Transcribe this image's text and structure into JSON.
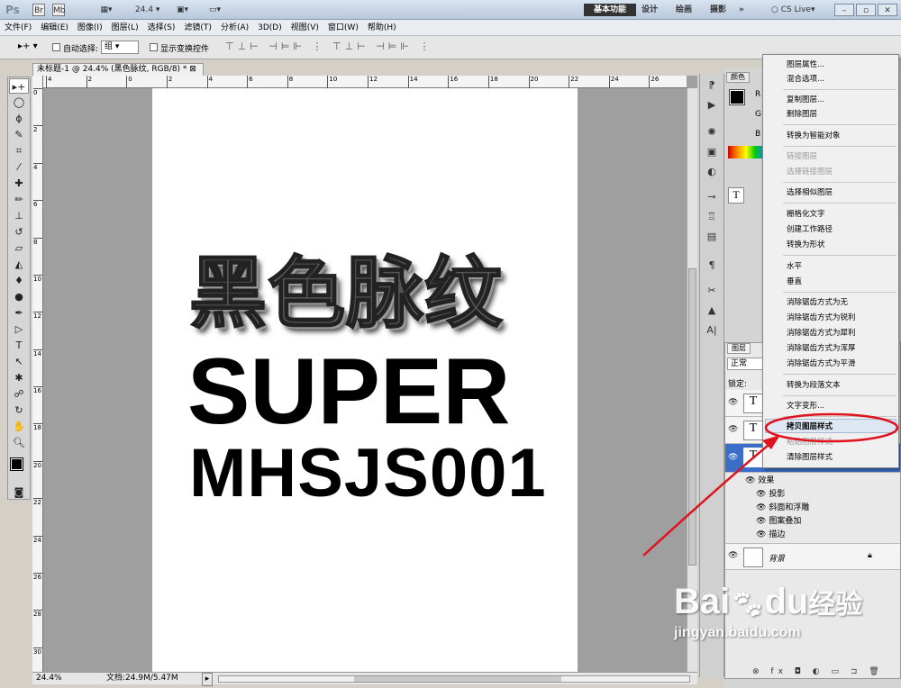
{
  "app": {
    "logo": "Ps",
    "zoom": "24.4",
    "workspaces": [
      "基本功能",
      "设计",
      "绘画",
      "摄影"
    ],
    "cslive": "CS Live"
  },
  "menu": [
    "文件(F)",
    "编辑(E)",
    "图像(I)",
    "图层(L)",
    "选择(S)",
    "滤镜(T)",
    "分析(A)",
    "3D(D)",
    "视图(V)",
    "窗口(W)",
    "帮助(H)"
  ],
  "options": {
    "auto_select": "自动选择:",
    "auto_select_value": "组",
    "show_transform": "显示变换控件"
  },
  "document": {
    "tab": "未标题-1 @ 24.4% (黑色脉纹, RGB/8) *",
    "zoom_status": "24.4%",
    "doc_size": "文档:24.9M/5.47M",
    "hruler_ticks": [
      "4",
      "2",
      "0",
      "2",
      "4",
      "6",
      "8",
      "10",
      "12",
      "14",
      "16",
      "18",
      "20",
      "22",
      "24",
      "26"
    ],
    "vruler_ticks": [
      "0",
      "2",
      "4",
      "6",
      "8",
      "10",
      "12",
      "14",
      "16",
      "18",
      "20",
      "22",
      "24",
      "26",
      "28",
      "30"
    ]
  },
  "canvas": {
    "line1": "黑色脉纹",
    "line2": "SUPER",
    "line3": "MHSJS001"
  },
  "panels": {
    "color_tab": "颜色",
    "r": "R",
    "g": "G",
    "b": "B",
    "layers_tab": "图层",
    "blend_mode": "正常",
    "lock": "锁定:"
  },
  "layers": {
    "effects_label": "效果",
    "effects": [
      "投影",
      "斜面和浮雕",
      "图案叠加",
      "描边"
    ],
    "background": "背景"
  },
  "context_menu": {
    "items": [
      {
        "label": "图层属性...",
        "disabled": false
      },
      {
        "label": "混合选项...",
        "disabled": false
      },
      {
        "label": "复制图层...",
        "disabled": false
      },
      {
        "label": "删除图层",
        "disabled": false
      },
      {
        "label": "转换为智能对象",
        "disabled": false
      },
      {
        "label": "链接图层",
        "disabled": true
      },
      {
        "label": "选择链接图层",
        "disabled": true
      },
      {
        "label": "选择相似图层",
        "disabled": false
      },
      {
        "label": "栅格化文字",
        "disabled": false
      },
      {
        "label": "创建工作路径",
        "disabled": false
      },
      {
        "label": "转换为形状",
        "disabled": false
      },
      {
        "label": "水平",
        "disabled": false
      },
      {
        "label": "垂直",
        "disabled": false
      },
      {
        "label": "消除锯齿方式为无",
        "disabled": false
      },
      {
        "label": "消除锯齿方式为锐利",
        "disabled": false
      },
      {
        "label": "消除锯齿方式为犀利",
        "disabled": false
      },
      {
        "label": "消除锯齿方式为浑厚",
        "disabled": false
      },
      {
        "label": "消除锯齿方式为平滑",
        "disabled": false
      },
      {
        "label": "转换为段落文本",
        "disabled": false
      },
      {
        "label": "文字变形...",
        "disabled": false
      },
      {
        "label": "拷贝图层样式",
        "disabled": false
      },
      {
        "label": "粘贴图层样式",
        "disabled": true
      },
      {
        "label": "清除图层样式",
        "disabled": false
      }
    ]
  },
  "watermark": {
    "brand": "Bai",
    "brand2": "du",
    "brand3": "经验",
    "url": "jingyan.baidu.com"
  },
  "colors": {
    "annotation": "#e0141e",
    "selected_layer": "#3a6ec8"
  }
}
